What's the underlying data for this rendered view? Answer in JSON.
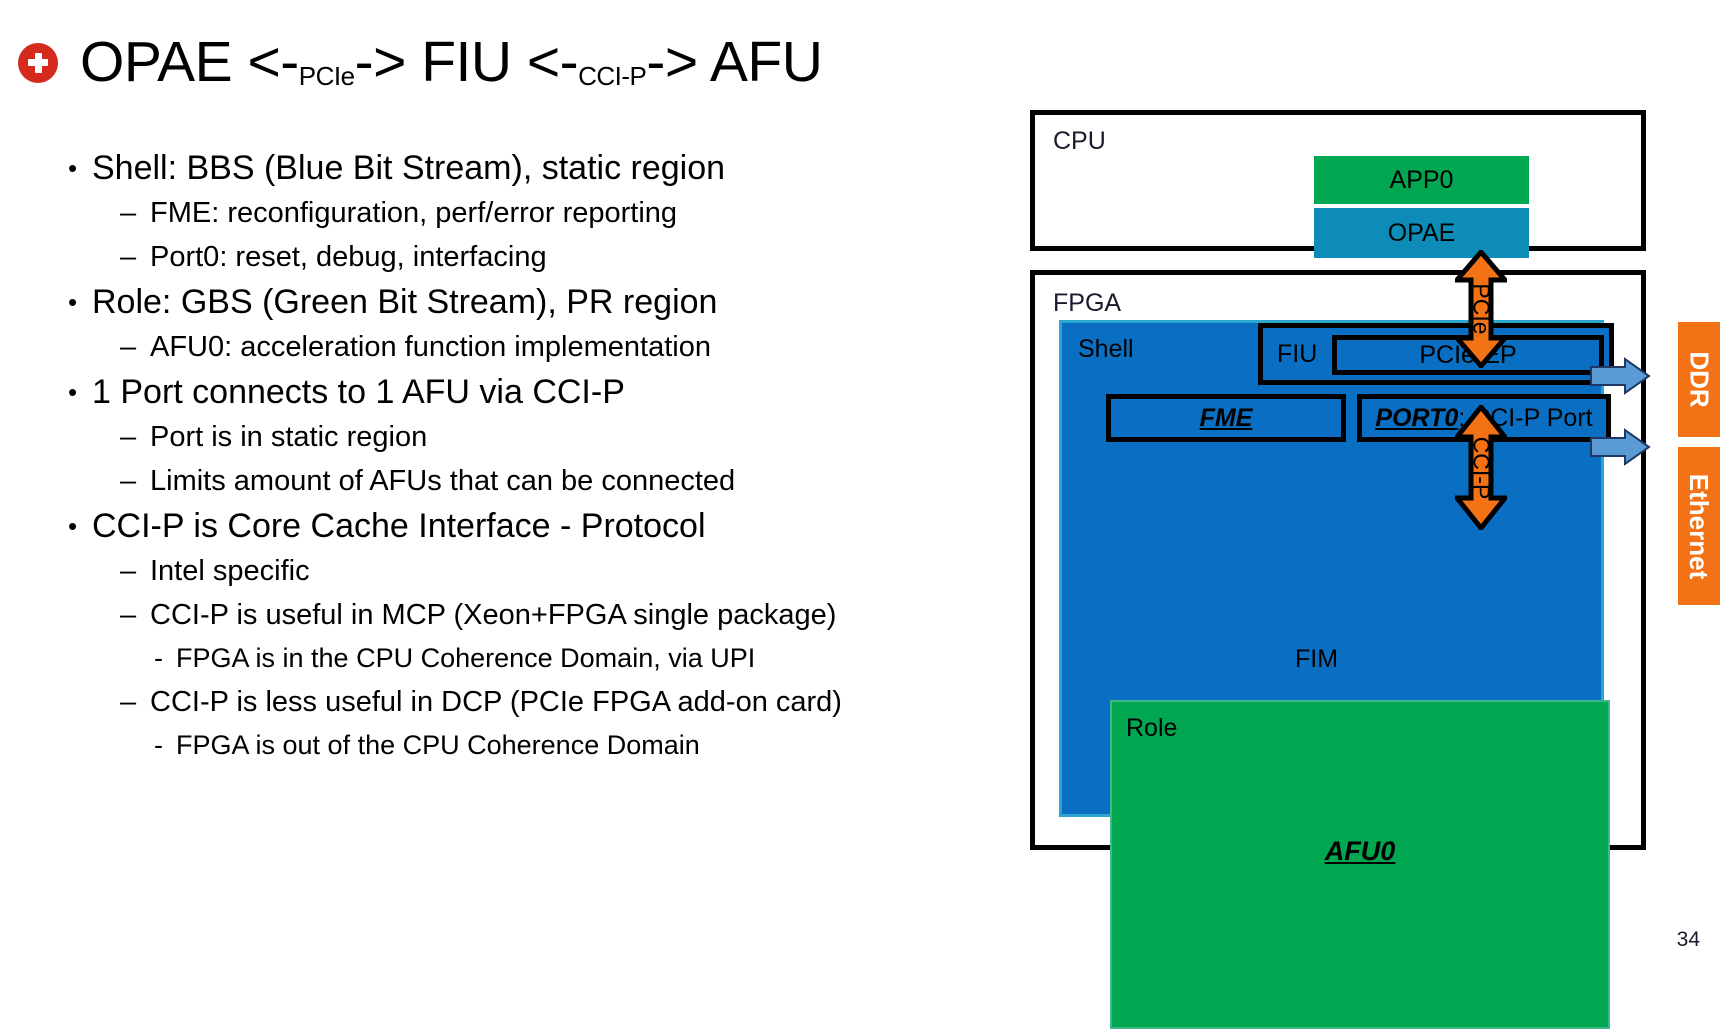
{
  "slide": {
    "title_main_1": "OPAE <-",
    "title_sub_1": "PCIe",
    "title_main_2": "-> FIU <-",
    "title_sub_2": "CCI-P",
    "title_main_3": "-> AFU",
    "title_bullet_icon": "red-circle-plus-icon",
    "number": "34"
  },
  "bullets": [
    {
      "level": 1,
      "marker": "•",
      "text": "Shell: BBS (Blue Bit Stream), static region"
    },
    {
      "level": 2,
      "marker": "–",
      "text": "FME: reconfiguration, perf/error reporting"
    },
    {
      "level": 2,
      "marker": "–",
      "text": "Port0: reset, debug, interfacing"
    },
    {
      "level": 1,
      "marker": "•",
      "text": "Role: GBS (Green Bit Stream), PR region"
    },
    {
      "level": 2,
      "marker": "–",
      "text": "AFU0: acceleration function implementation"
    },
    {
      "level": 1,
      "marker": "•",
      "text": "1 Port connects to 1 AFU via CCI-P"
    },
    {
      "level": 2,
      "marker": "–",
      "text": "Port is in static region"
    },
    {
      "level": 2,
      "marker": "–",
      "text": "Limits amount of AFUs that can be connected"
    },
    {
      "level": 1,
      "marker": "•",
      "text": "CCI-P is Core Cache Interface - Protocol"
    },
    {
      "level": 2,
      "marker": "–",
      "text": "Intel specific"
    },
    {
      "level": 2,
      "marker": "–",
      "text": "CCI-P is useful in MCP (Xeon+FPGA single package)"
    },
    {
      "level": 3,
      "marker": "-",
      "text": "FPGA is in the CPU Coherence Domain, via UPI"
    },
    {
      "level": 2,
      "marker": "–",
      "text": "CCI-P is less useful in DCP (PCIe FPGA add-on card)"
    },
    {
      "level": 3,
      "marker": "-",
      "text": "FPGA is out of the CPU Coherence Domain"
    }
  ],
  "diagram": {
    "cpu": {
      "label": "CPU",
      "app0": {
        "label": "APP0",
        "color": "#00a650"
      },
      "opae": {
        "label": "OPAE",
        "color": "#0e8cb8"
      }
    },
    "fpga": {
      "label": "FPGA",
      "shell": {
        "label": "Shell",
        "color": "#0a6fc2",
        "fim_label": "FIM",
        "fiu": {
          "label": "FIU"
        },
        "pcie_ep": {
          "label": "PCIe-EP"
        },
        "fme": {
          "label": "FME"
        },
        "port0": {
          "label_bold": "PORT0",
          "label_rest": ": CCI-P Port"
        }
      },
      "role": {
        "label": "Role",
        "color": "#00a650",
        "afu0": "AFU0"
      }
    },
    "arrows": {
      "pcie": {
        "label": "PCIe",
        "color": "#f47216"
      },
      "ccip": {
        "label": "CCI-P",
        "color": "#f47216"
      }
    },
    "peripherals": [
      {
        "label": "DDR",
        "color": "#f47216"
      },
      {
        "label": "Ethernet",
        "color": "#f47216"
      }
    ]
  }
}
